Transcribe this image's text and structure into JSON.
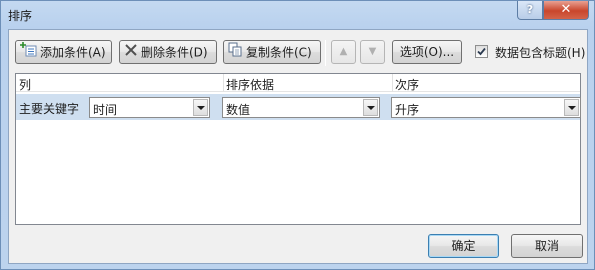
{
  "window": {
    "title": "排序",
    "help_label": "?",
    "close_label": "✕"
  },
  "toolbar": {
    "add_label": "添加条件(A)",
    "delete_label": "删除条件(D)",
    "copy_label": "复制条件(C)",
    "move_up_label": "▲",
    "move_down_label": "▼",
    "options_label": "选项(O)...",
    "header_checkbox_label": "数据包含标题(H)",
    "header_checkbox_checked": true
  },
  "grid": {
    "columns": [
      "列",
      "排序依据",
      "次序"
    ],
    "rows": [
      {
        "label": "主要关键字",
        "column_value": "时间",
        "sort_on_value": "数值",
        "order_value": "升序"
      }
    ]
  },
  "footer": {
    "ok_label": "确定",
    "cancel_label": "取消"
  }
}
